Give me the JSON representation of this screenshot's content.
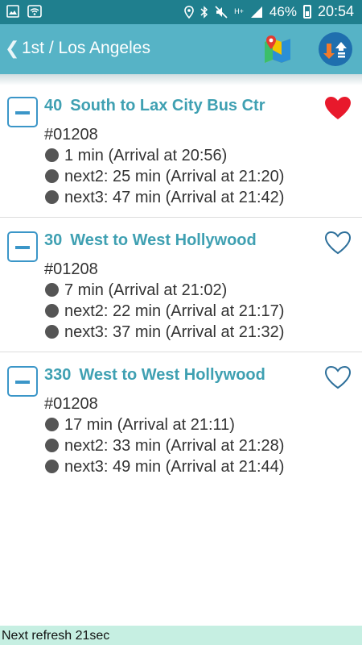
{
  "status_bar": {
    "battery": "46%",
    "time": "20:54",
    "network": "H+"
  },
  "header": {
    "back_icon": "chevron-left-icon",
    "title": "1st / Los Angeles"
  },
  "routes": [
    {
      "number": "40",
      "destination": "South to Lax City Bus Ctr",
      "stop_id": "#01208",
      "favorite": true,
      "arrivals": [
        "1 min (Arrival at 20:56)",
        "next2: 25 min (Arrival at 21:20)",
        "next3: 47 min (Arrival at 21:42)"
      ]
    },
    {
      "number": "30",
      "destination": "West to West Hollywood",
      "stop_id": "#01208",
      "favorite": false,
      "arrivals": [
        "7 min (Arrival at 21:02)",
        "next2: 22 min (Arrival at 21:17)",
        "next3: 37 min (Arrival at 21:32)"
      ]
    },
    {
      "number": "330",
      "destination": "West to West Hollywood",
      "stop_id": "#01208",
      "favorite": false,
      "arrivals": [
        "17 min (Arrival at 21:11)",
        "next2: 33 min (Arrival at 21:28)",
        "next3: 49 min (Arrival at 21:44)"
      ]
    }
  ],
  "footer": {
    "refresh_text": "Next refresh 21sec"
  },
  "colors": {
    "header": "#56b3c6",
    "status_bar": "#1f7f8e",
    "route_title": "#3fa0b2",
    "favorite_active": "#e8192c",
    "footer": "#c6efe2"
  }
}
